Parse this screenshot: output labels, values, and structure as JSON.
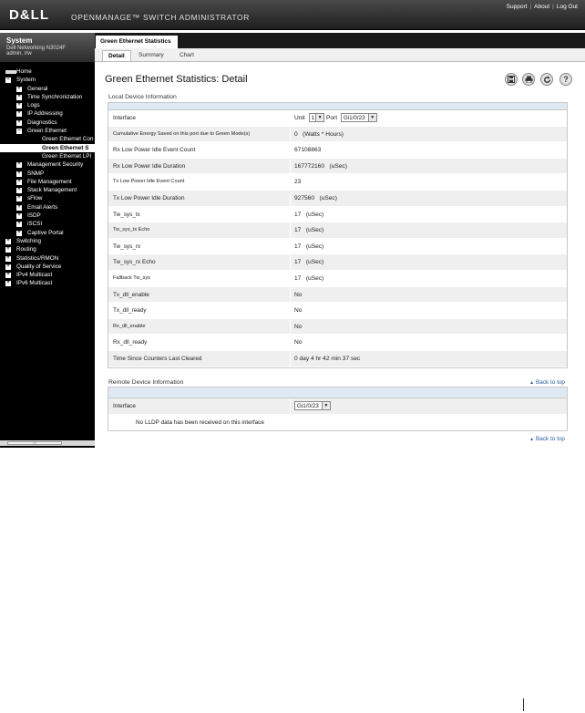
{
  "header": {
    "logo": "D&LL",
    "title": "OPENMANAGE™ SWITCH ADMINISTRATOR",
    "links": [
      "Support",
      "About",
      "Log Out"
    ],
    "separator": "|"
  },
  "sidebar": {
    "system_title": "System",
    "device": "Dell Networking N3024F",
    "user": "admin, r/w",
    "tree": [
      {
        "label": "Home",
        "level": 0,
        "box": "home"
      },
      {
        "label": "System",
        "level": 0,
        "box": "-"
      },
      {
        "label": "General",
        "level": 1,
        "box": "+"
      },
      {
        "label": "Time Synchronization",
        "level": 1,
        "box": "+"
      },
      {
        "label": "Logs",
        "level": 1,
        "box": "+"
      },
      {
        "label": "IP Addressing",
        "level": 1,
        "box": "+"
      },
      {
        "label": "Diagnostics",
        "level": 1,
        "box": "+"
      },
      {
        "label": "Green Ethernet",
        "level": 1,
        "box": "-"
      },
      {
        "label": "Green Ethernet Con",
        "level": 2,
        "box": ""
      },
      {
        "label": "Green Ethernet S",
        "level": 2,
        "box": "",
        "selected": true
      },
      {
        "label": "Green Ethernet LPI",
        "level": 2,
        "box": ""
      },
      {
        "label": "Management Security",
        "level": 1,
        "box": "+"
      },
      {
        "label": "SNMP",
        "level": 1,
        "box": "+"
      },
      {
        "label": "File Management",
        "level": 1,
        "box": "+"
      },
      {
        "label": "Stack Management",
        "level": 1,
        "box": "+"
      },
      {
        "label": "sFlow",
        "level": 1,
        "box": "+"
      },
      {
        "label": "Email Alerts",
        "level": 1,
        "box": "+"
      },
      {
        "label": "ISDP",
        "level": 1,
        "box": "+"
      },
      {
        "label": "iSCSI",
        "level": 1,
        "box": "+"
      },
      {
        "label": "Captive Portal",
        "level": 1,
        "box": "+"
      },
      {
        "label": "Switching",
        "level": 0,
        "box": "+"
      },
      {
        "label": "Routing",
        "level": 0,
        "box": "+"
      },
      {
        "label": "Statistics/RMON",
        "level": 0,
        "box": "+"
      },
      {
        "label": "Quality of Service",
        "level": 0,
        "box": "+"
      },
      {
        "label": "IPv4 Multicast",
        "level": 0,
        "box": "+"
      },
      {
        "label": "IPv6 Multicast",
        "level": 0,
        "box": "+"
      }
    ],
    "scroll_grip": "III"
  },
  "main": {
    "tab": "Green Ethernet Statistics",
    "subtabs": [
      "Detail",
      "Summary",
      "Chart"
    ],
    "title": "Green Ethernet Statistics: Detail",
    "tools": [
      "save-icon",
      "print-icon",
      "refresh-icon",
      "help-icon"
    ],
    "local_section": "Local Device Information",
    "local_rows": [
      {
        "label": "Interface",
        "value": ""
      },
      {
        "label": "Cumulative Energy Saved on this port due to Green Mode(s)",
        "value": "0   (Watts * Hours)"
      },
      {
        "label": "Rx Low Power Idle Event Count",
        "value": "67108863"
      },
      {
        "label": "Rx Low Power Idle Duration",
        "value": "167772160   (uSec)"
      },
      {
        "label": "Tx Low Power Idle Event Count",
        "value": "23"
      },
      {
        "label": "Tx Low Power Idle Duration",
        "value": "927560   (uSec)"
      },
      {
        "label": "Tw_sys_tx",
        "value": "17   (uSec)"
      },
      {
        "label": "Tw_sys_tx Echo",
        "value": "17   (uSec)"
      },
      {
        "label": "Tw_sys_rx",
        "value": "17   (uSec)"
      },
      {
        "label": "Tw_sys_rx Echo",
        "value": "17   (uSec)"
      },
      {
        "label": "Fallback Tw_sys",
        "value": "17   (uSec)"
      },
      {
        "label": "Tx_dll_enable",
        "value": "No"
      },
      {
        "label": "Tx_dll_ready",
        "value": "No"
      },
      {
        "label": "Rx_dll_enable",
        "value": "No"
      },
      {
        "label": "Rx_dll_ready",
        "value": "No"
      },
      {
        "label": "Time Since Counters Last Cleared",
        "value": "0 day 4 hr 42 min 37 sec"
      }
    ],
    "interface_unit_label": "Unit",
    "interface_unit_value": "1",
    "interface_port_label": "Port",
    "interface_port_value": "Gi1/0/23",
    "back_to_top": "Back to top",
    "remote_section": "Remote Device Information",
    "remote_interface_label": "Interface",
    "remote_interface_value": "Gi1/0/23",
    "remote_message": "No LLDP data has been received on this interface"
  }
}
